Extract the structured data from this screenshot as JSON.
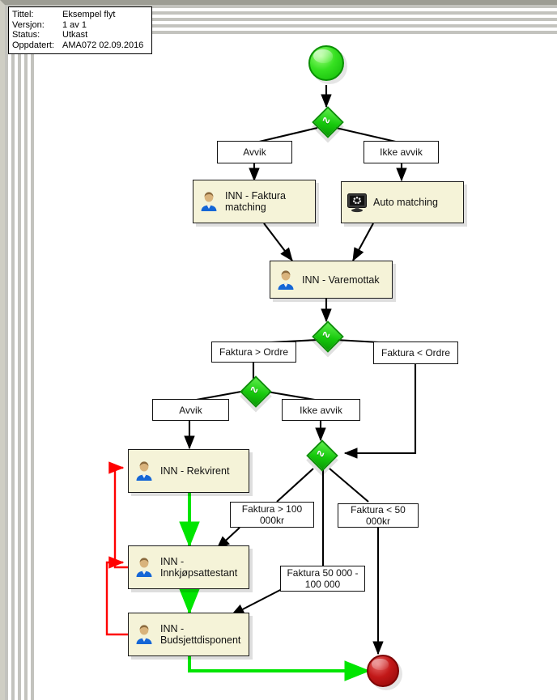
{
  "header": {
    "rows": [
      {
        "key": "Tittel:",
        "value": "Eksempel flyt"
      },
      {
        "key": "Versjon:",
        "value": "1 av 1"
      },
      {
        "key": "Status:",
        "value": "Utkast"
      },
      {
        "key": "Oppdatert:",
        "value": "AMA072  02.09.2016"
      }
    ]
  },
  "diagram": {
    "start_event": "start-event",
    "end_event": "end-event",
    "gateways": [
      "gateway-1",
      "gateway-2",
      "gateway-3",
      "gateway-4"
    ],
    "tasks": [
      {
        "id": "task-faktura-matching",
        "label": "INN - Faktura\nmatching",
        "icon": "user-icon"
      },
      {
        "id": "task-auto-matching",
        "label": "Auto matching",
        "icon": "monitor-icon"
      },
      {
        "id": "task-varemottak",
        "label": "INN - Varemottak",
        "icon": "user-icon"
      },
      {
        "id": "task-rekvirent",
        "label": "INN - Rekvirent",
        "icon": "user-icon"
      },
      {
        "id": "task-innkjopsattestant",
        "label": "INN -\nInnkjøpsattestant",
        "icon": "user-icon"
      },
      {
        "id": "task-budsjettdisponent",
        "label": "INN -\nBudsjettdisponent",
        "icon": "user-icon"
      }
    ],
    "conditions": [
      {
        "id": "cond-avvik-1",
        "label": "Avvik"
      },
      {
        "id": "cond-ikke-avvik-1",
        "label": "Ikke avvik"
      },
      {
        "id": "cond-faktura-storre-ordre",
        "label": "Faktura > Ordre"
      },
      {
        "id": "cond-faktura-mindre-ordre",
        "label": "Faktura < Ordre"
      },
      {
        "id": "cond-avvik-2",
        "label": "Avvik"
      },
      {
        "id": "cond-ikke-avvik-2",
        "label": "Ikke avvik"
      },
      {
        "id": "cond-faktura-over-100k",
        "label": "Faktura > 100\n000kr"
      },
      {
        "id": "cond-faktura-under-50k",
        "label": "Faktura < 50 000kr"
      },
      {
        "id": "cond-faktura-50-100k",
        "label": "Faktura 50 000 -\n100 000"
      }
    ],
    "gateway_glyph": "∿",
    "colors": {
      "start": "#18c40c",
      "end": "#c21818",
      "gateway": "#16c90c",
      "task_fill": "#f5f3d8",
      "approve_flow": "#00e500",
      "reject_flow": "#ff0000",
      "default_flow": "#000000"
    }
  }
}
